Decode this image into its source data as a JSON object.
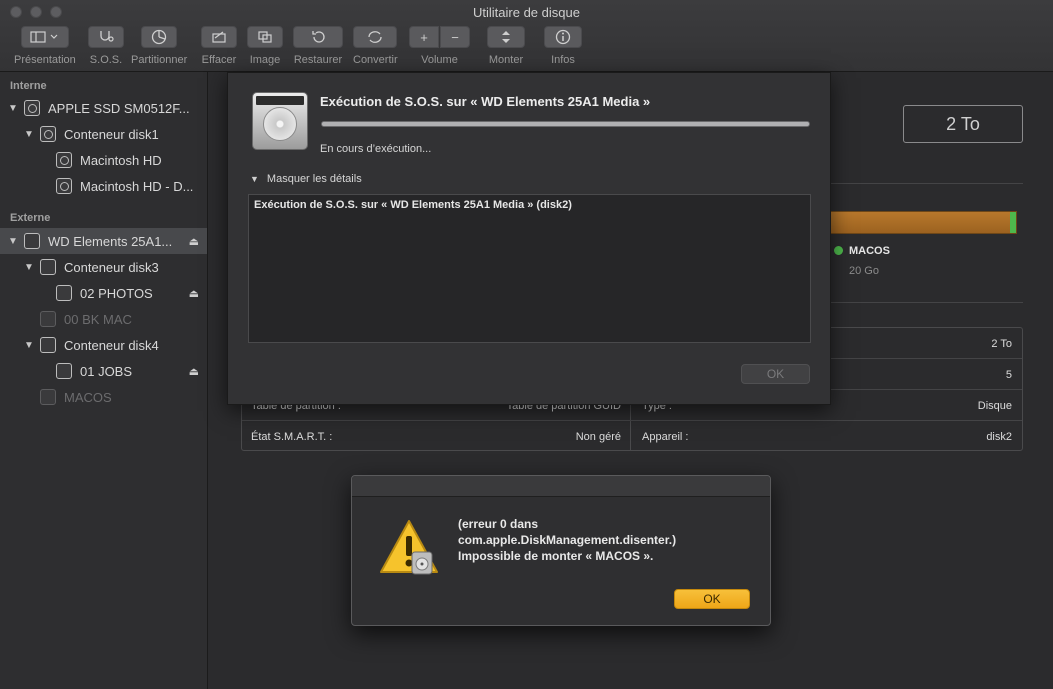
{
  "window": {
    "title": "Utilitaire de disque"
  },
  "toolbar": {
    "presentation": "Présentation",
    "sos": "S.O.S.",
    "partition": "Partitionner",
    "erase": "Effacer",
    "image": "Image",
    "restore": "Restaurer",
    "convert": "Convertir",
    "volume": "Volume",
    "mount": "Monter",
    "info": "Infos",
    "volume_add": "+",
    "volume_remove": "−"
  },
  "sidebar": {
    "internal_header": "Interne",
    "external_header": "Externe",
    "items": [
      {
        "label": "APPLE SSD SM0512F..."
      },
      {
        "label": "Conteneur disk1"
      },
      {
        "label": "Macintosh HD"
      },
      {
        "label": "Macintosh HD - D..."
      },
      {
        "label": "WD Elements 25A1..."
      },
      {
        "label": "Conteneur disk3"
      },
      {
        "label": "02 PHOTOS"
      },
      {
        "label": "00 BK MAC"
      },
      {
        "label": "Conteneur disk4"
      },
      {
        "label": "01 JOBS"
      },
      {
        "label": "MACOS"
      }
    ]
  },
  "main": {
    "capacity": "2 To",
    "legend": {
      "name": "MACOS",
      "size": "20 Go"
    },
    "usage_green_fraction": 0.03,
    "info_rows": [
      {
        "right_value": "2 To"
      },
      {
        "right_value": "5"
      },
      {
        "left_label": "Table de partition :",
        "left_value": "Table de partition GUID",
        "right_label": "Type :",
        "right_value": "Disque"
      },
      {
        "left_label": "État S.M.A.R.T. :",
        "left_value": "Non géré",
        "right_label": "Appareil :",
        "right_value": "disk2"
      }
    ]
  },
  "sos_sheet": {
    "title": "Exécution de S.O.S. sur « WD Elements 25A1 Media »",
    "status": "En cours d’exécution...",
    "progress_fraction": 1.0,
    "details_toggle": "Masquer les détails",
    "log_line": "Exécution de S.O.S. sur « WD Elements 25A1 Media » (disk2)",
    "ok_label": "OK"
  },
  "error_alert": {
    "line1": "(erreur 0 dans",
    "line2": "com.apple.DiskManagement.disenter.)",
    "line3": "Impossible de monter « MACOS ».",
    "ok_label": "OK"
  },
  "colors": {
    "accent_ok": "#f2b126",
    "usage_orange": "#b8782c",
    "usage_green": "#4eb84c"
  }
}
